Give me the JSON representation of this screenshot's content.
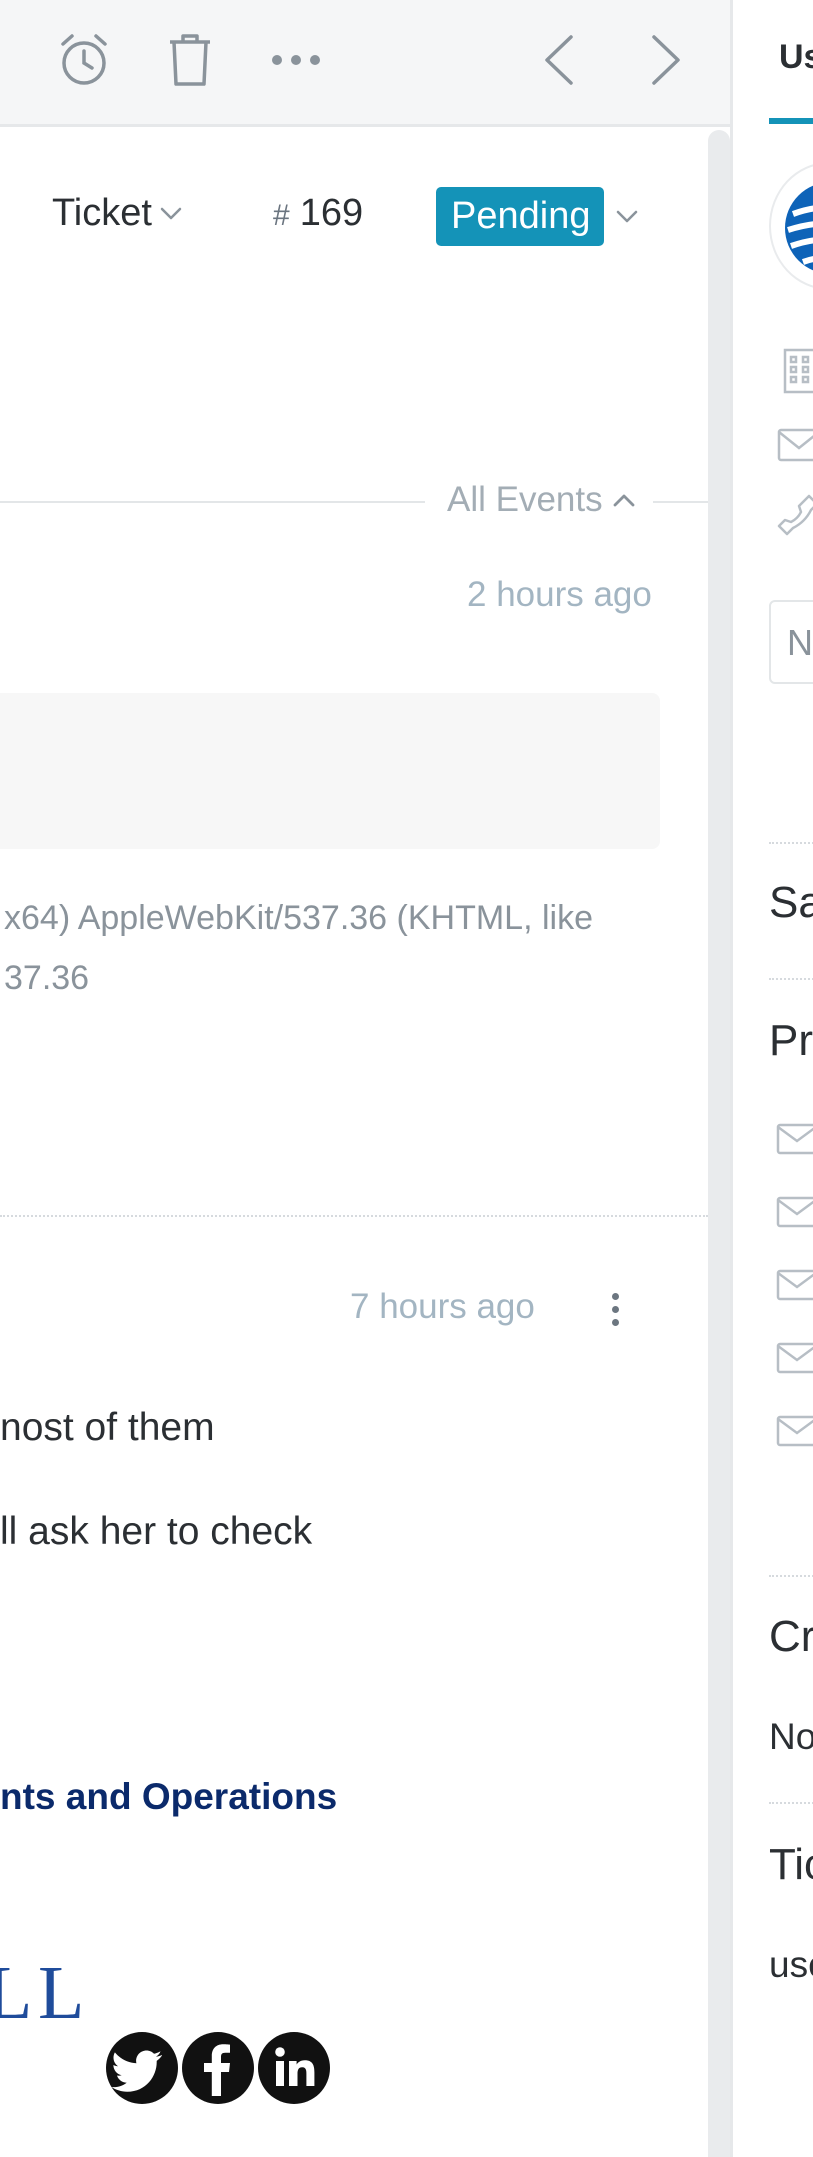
{
  "toolbar": {
    "icons": [
      "alarm-clock-icon",
      "trash-icon",
      "more-icon",
      "chevron-left-icon",
      "chevron-right-icon"
    ]
  },
  "ticket": {
    "type_label": "Ticket",
    "number_prefix": "#",
    "number": "169",
    "status": "Pending",
    "status_color": "#1493b8"
  },
  "events": {
    "toggle_label": "All Events",
    "event1": {
      "time": "2 hours ago",
      "useragent_line1": "x64) AppleWebKit/537.36 (KHTML, like",
      "useragent_line2": "37.36"
    },
    "event2": {
      "time": "7 hours ago",
      "message_line1": "nost of them",
      "message_line2": "ll ask her to check",
      "signature_title": "nts and Operations",
      "signature_logo_1": "L",
      "signature_logo_2": "L"
    }
  },
  "colors": {
    "accent": "#1493b8",
    "signature": "#0b2a6b",
    "muted": "#a3b5c2"
  },
  "right_panel": {
    "tab_label": "Us",
    "note_placeholder": "N",
    "sections": {
      "sa": "Sa",
      "pr": "Pr",
      "cr": "Cr",
      "cr_value": "No",
      "ti": "Tic",
      "ti_value": "use"
    }
  }
}
